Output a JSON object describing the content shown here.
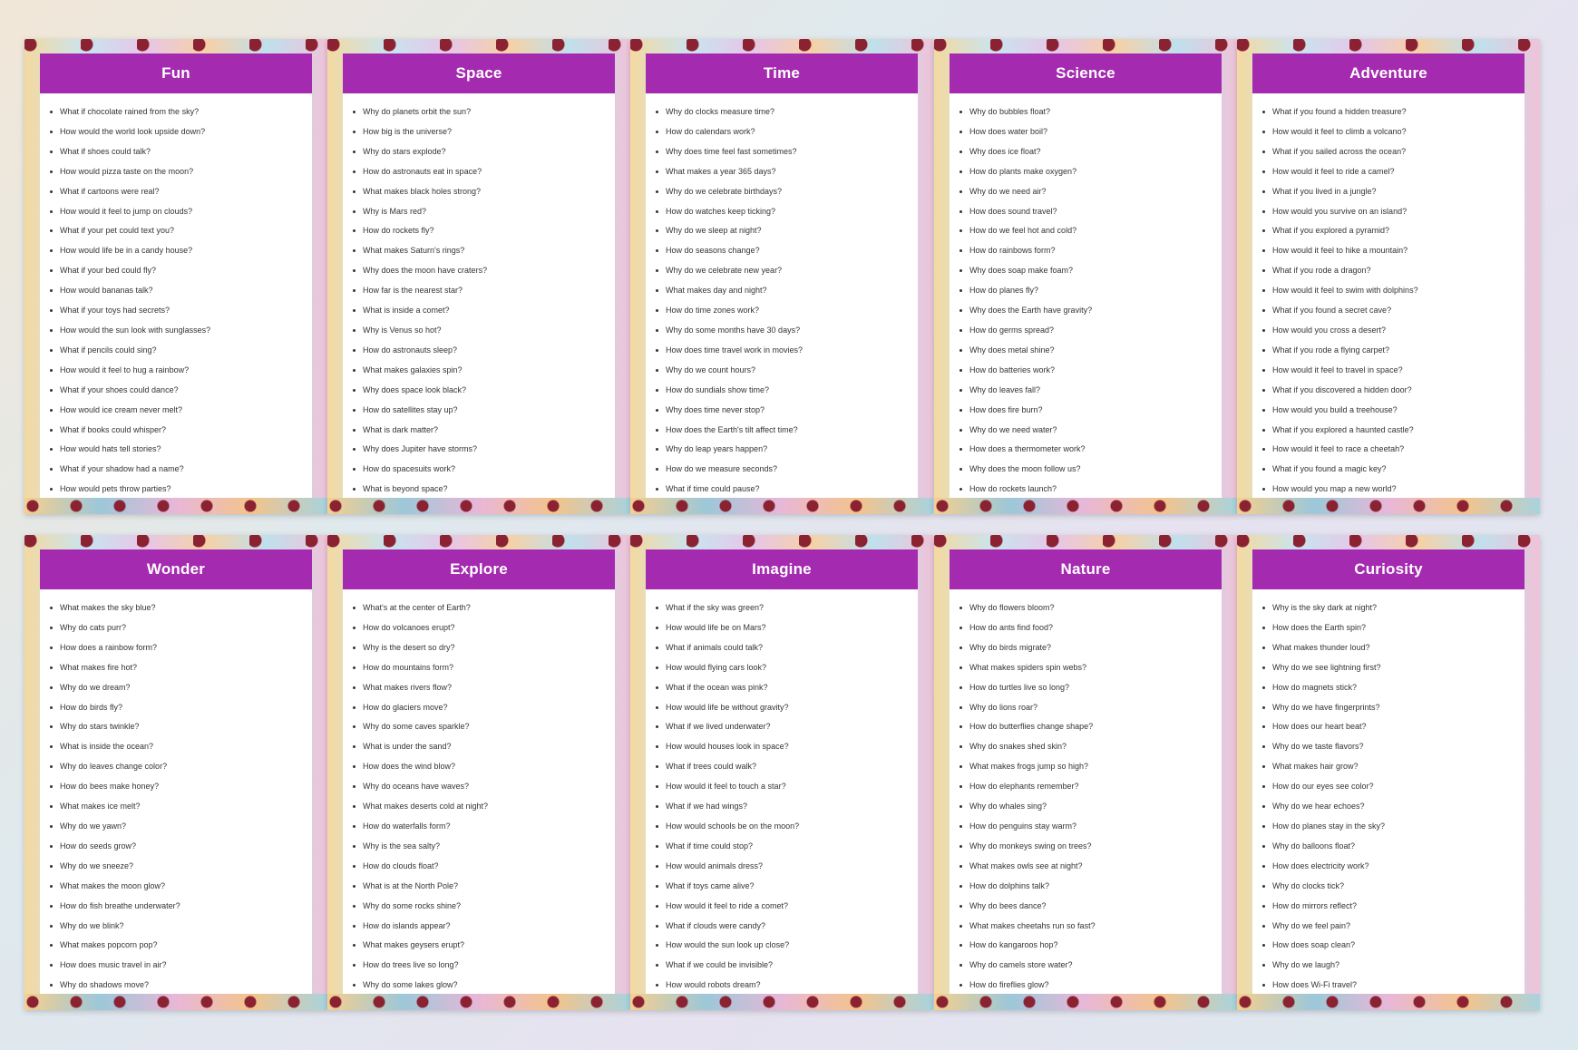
{
  "cards": [
    {
      "title": "Fun",
      "questions": [
        "What if chocolate rained from the sky?",
        "How would the world look upside down?",
        "What if shoes could talk?",
        "How would pizza taste on the moon?",
        "What if cartoons were real?",
        "How would it feel to jump on clouds?",
        "What if your pet could text you?",
        "How would life be in a candy house?",
        "What if your bed could fly?",
        "How would bananas talk?",
        "What if your toys had secrets?",
        "How would the sun look with sunglasses?",
        "What if pencils could sing?",
        "How would it feel to hug a rainbow?",
        "What if your shoes could dance?",
        "How would ice cream never melt?",
        "What if books could whisper?",
        "How would hats tell stories?",
        "What if your shadow had a name?",
        "How would pets throw parties?"
      ]
    },
    {
      "title": "Space",
      "questions": [
        "Why do planets orbit the sun?",
        "How big is the universe?",
        "Why do stars explode?",
        "How do astronauts eat in space?",
        "What makes black holes strong?",
        "Why is Mars red?",
        "How do rockets fly?",
        "What makes Saturn's rings?",
        "Why does the moon have craters?",
        "How far is the nearest star?",
        "What is inside a comet?",
        "Why is Venus so hot?",
        "How do astronauts sleep?",
        "What makes galaxies spin?",
        "Why does space look black?",
        "How do satellites stay up?",
        "What is dark matter?",
        "Why does Jupiter have storms?",
        "How do spacesuits work?",
        "What is beyond space?"
      ]
    },
    {
      "title": "Time",
      "questions": [
        "Why do clocks measure time?",
        "How do calendars work?",
        "Why does time feel fast sometimes?",
        "What makes a year 365 days?",
        "Why do we celebrate birthdays?",
        "How do watches keep ticking?",
        "Why do we sleep at night?",
        "How do seasons change?",
        "Why do we celebrate new year?",
        "What makes day and night?",
        "How do time zones work?",
        "Why do some months have 30 days?",
        "How does time travel work in movies?",
        "Why do we count hours?",
        "How do sundials show time?",
        "Why does time never stop?",
        "How does the Earth's tilt affect time?",
        "Why do leap years happen?",
        "How do we measure seconds?",
        "What if time could pause?"
      ]
    },
    {
      "title": "Science",
      "questions": [
        "Why do bubbles float?",
        "How does water boil?",
        "Why does ice float?",
        "How do plants make oxygen?",
        "Why do we need air?",
        "How does sound travel?",
        "How do we feel hot and cold?",
        "How do rainbows form?",
        "Why does soap make foam?",
        "How do planes fly?",
        "Why does the Earth have gravity?",
        "How do germs spread?",
        "Why does metal shine?",
        "How do batteries work?",
        "Why do leaves fall?",
        "How does fire burn?",
        "Why do we need water?",
        "How does a thermometer work?",
        "Why does the moon follow us?",
        "How do rockets launch?"
      ]
    },
    {
      "title": "Adventure",
      "questions": [
        "What if you found a hidden treasure?",
        "How would it feel to climb a volcano?",
        "What if you sailed across the ocean?",
        "How would it feel to ride a camel?",
        "What if you lived in a jungle?",
        "How would you survive on an island?",
        "What if you explored a pyramid?",
        "How would it feel to hike a mountain?",
        "What if you rode a dragon?",
        "How would it feel to swim with dolphins?",
        "What if you found a secret cave?",
        "How would you cross a desert?",
        "What if you rode a flying carpet?",
        "How would it feel to travel in space?",
        "What if you discovered a hidden door?",
        "How would you build a treehouse?",
        "What if you explored a haunted castle?",
        "How would it feel to race a cheetah?",
        "What if you found a magic key?",
        "How would you map a new world?"
      ]
    },
    {
      "title": "Wonder",
      "questions": [
        "What makes the sky blue?",
        "Why do cats purr?",
        "How does a rainbow form?",
        "What makes fire hot?",
        "Why do we dream?",
        "How do birds fly?",
        "Why do stars twinkle?",
        "What is inside the ocean?",
        "Why do leaves change color?",
        "How do bees make honey?",
        "What makes ice melt?",
        "Why do we yawn?",
        "How do seeds grow?",
        "Why do we sneeze?",
        "What makes the moon glow?",
        "How do fish breathe underwater?",
        "Why do we blink?",
        "What makes popcorn pop?",
        "How does music travel in air?",
        "Why do shadows move?"
      ]
    },
    {
      "title": "Explore",
      "questions": [
        "What's at the center of Earth?",
        "How do volcanoes erupt?",
        "Why is the desert so dry?",
        "How do mountains form?",
        "What makes rivers flow?",
        "How do glaciers move?",
        "Why do some caves sparkle?",
        "What is under the sand?",
        "How does the wind blow?",
        "Why do oceans have waves?",
        "What makes deserts cold at night?",
        "How do waterfalls form?",
        "Why is the sea salty?",
        "How do clouds float?",
        "What is at the North Pole?",
        "Why do some rocks shine?",
        "How do islands appear?",
        "What makes geysers erupt?",
        "How do trees live so long?",
        "Why do some lakes glow?"
      ]
    },
    {
      "title": "Imagine",
      "questions": [
        "What if the sky was green?",
        "How would life be on Mars?",
        "What if animals could talk?",
        "How would flying cars look?",
        "What if the ocean was pink?",
        "How would life be without gravity?",
        "What if we lived underwater?",
        "How would houses look in space?",
        "What if trees could walk?",
        "How would it feel to touch a star?",
        "What if we had wings?",
        "How would schools be on the moon?",
        "What if time could stop?",
        "How would animals dress?",
        "What if toys came alive?",
        "How would it feel to ride a comet?",
        "What if clouds were candy?",
        "How would the sun look up close?",
        "What if we could be invisible?",
        "How would robots dream?"
      ]
    },
    {
      "title": "Nature",
      "questions": [
        "Why do flowers bloom?",
        "How do ants find food?",
        "Why do birds migrate?",
        "What makes spiders spin webs?",
        "How do turtles live so long?",
        "Why do lions roar?",
        "How do butterflies change shape?",
        "Why do snakes shed skin?",
        "What makes frogs jump so high?",
        "How do elephants remember?",
        "Why do whales sing?",
        "How do penguins stay warm?",
        "Why do monkeys swing on trees?",
        "What makes owls see at night?",
        "How do dolphins talk?",
        "Why do bees dance?",
        "What makes cheetahs run so fast?",
        "How do kangaroos hop?",
        "Why do camels store water?",
        "How do fireflies glow?"
      ]
    },
    {
      "title": "Curiosity",
      "questions": [
        "Why is the sky dark at night?",
        "How does the Earth spin?",
        "What makes thunder loud?",
        "Why do we see lightning first?",
        "How do magnets stick?",
        "Why do we have fingerprints?",
        "How does our heart beat?",
        "Why do we taste flavors?",
        "What makes hair grow?",
        "How do our eyes see color?",
        "Why do we hear echoes?",
        "How do planes stay in the sky?",
        "Why do balloons float?",
        "How does electricity work?",
        "Why do clocks tick?",
        "How do mirrors reflect?",
        "Why do we feel pain?",
        "How does soap clean?",
        "Why do we laugh?",
        "How does Wi-Fi travel?"
      ]
    }
  ]
}
